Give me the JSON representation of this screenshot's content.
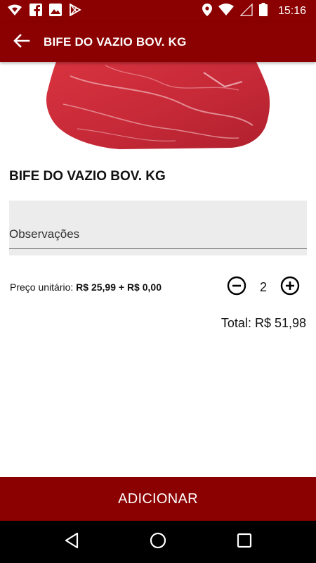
{
  "status_bar": {
    "time": "15:16",
    "icons": [
      "wifi-shield-icon",
      "facebook-icon",
      "image-icon",
      "play-store-icon",
      "location-icon",
      "wifi-icon",
      "signal-icon",
      "battery-icon"
    ]
  },
  "app_bar": {
    "title": "BIFE DO VAZIO BOV. KG",
    "back_icon": "arrow-left-icon"
  },
  "product": {
    "name": "BIFE DO VAZIO BOV. KG",
    "image": "beef-cut-image"
  },
  "observations": {
    "label": "Observações",
    "value": ""
  },
  "price": {
    "label": "Preço unitário:",
    "value": "R$ 25,99 + R$ 0,00"
  },
  "quantity": {
    "value": "2",
    "decrement_icon": "minus-circle-icon",
    "increment_icon": "plus-circle-icon"
  },
  "total": {
    "text": "Total: R$ 51,98"
  },
  "actions": {
    "add_label": "ADICIONAR"
  },
  "colors": {
    "primary": "#8b0000",
    "nav_bar": "#000000",
    "field_bg": "#ececec"
  }
}
